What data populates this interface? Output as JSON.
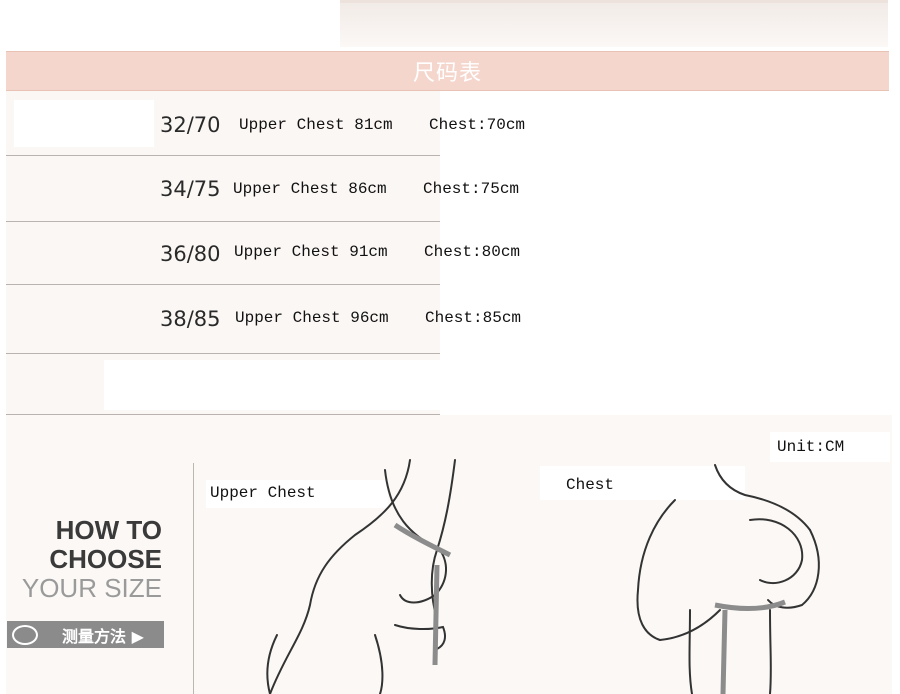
{
  "table": {
    "title": "尺码表",
    "rows": [
      {
        "size": "32/70",
        "upper": "Upper Chest 81cm",
        "chest": "Chest:70cm"
      },
      {
        "size": "34/75",
        "upper": "Upper Chest 86cm",
        "chest": "Chest:75cm"
      },
      {
        "size": "36/80",
        "upper": "Upper Chest 91cm",
        "chest": "Chest:80cm"
      },
      {
        "size": "38/85",
        "upper": "Upper Chest 96cm",
        "chest": "Chest:85cm"
      }
    ]
  },
  "guide": {
    "how_line1": "HOW TO",
    "how_line2": "CHOOSE",
    "your_size": "YOUR SIZE",
    "badge_text": "测量方法",
    "unit": "Unit:CM",
    "upper_chest_label": "Upper Chest",
    "chest_label": "Chest"
  },
  "colors": {
    "header": "#f5d6cd",
    "row_bg": "#fbf7f5",
    "badge": "#8b8b8b"
  }
}
